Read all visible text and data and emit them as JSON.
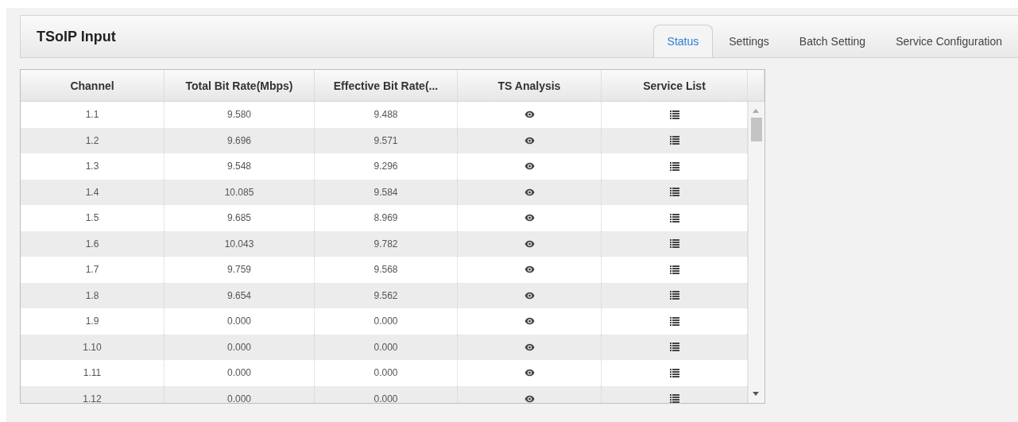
{
  "panel": {
    "title": "TSoIP Input"
  },
  "tabs": [
    {
      "label": "Status",
      "selected": true
    },
    {
      "label": "Settings",
      "selected": false
    },
    {
      "label": "Batch Setting",
      "selected": false
    },
    {
      "label": "Service Configuration",
      "selected": false
    }
  ],
  "table": {
    "columns": [
      "Channel",
      "Total Bit Rate(Mbps)",
      "Effective Bit Rate(...",
      "TS Analysis",
      "Service List"
    ],
    "rows": [
      {
        "channel": "1.1",
        "total": "9.580",
        "effective": "9.488"
      },
      {
        "channel": "1.2",
        "total": "9.696",
        "effective": "9.571"
      },
      {
        "channel": "1.3",
        "total": "9.548",
        "effective": "9.296"
      },
      {
        "channel": "1.4",
        "total": "10.085",
        "effective": "9.584"
      },
      {
        "channel": "1.5",
        "total": "9.685",
        "effective": "8.969"
      },
      {
        "channel": "1.6",
        "total": "10.043",
        "effective": "9.782"
      },
      {
        "channel": "1.7",
        "total": "9.759",
        "effective": "9.568"
      },
      {
        "channel": "1.8",
        "total": "9.654",
        "effective": "9.562"
      },
      {
        "channel": "1.9",
        "total": "0.000",
        "effective": "0.000"
      },
      {
        "channel": "1.10",
        "total": "0.000",
        "effective": "0.000"
      },
      {
        "channel": "1.11",
        "total": "0.000",
        "effective": "0.000"
      },
      {
        "channel": "1.12",
        "total": "0.000",
        "effective": "0.000"
      }
    ]
  }
}
